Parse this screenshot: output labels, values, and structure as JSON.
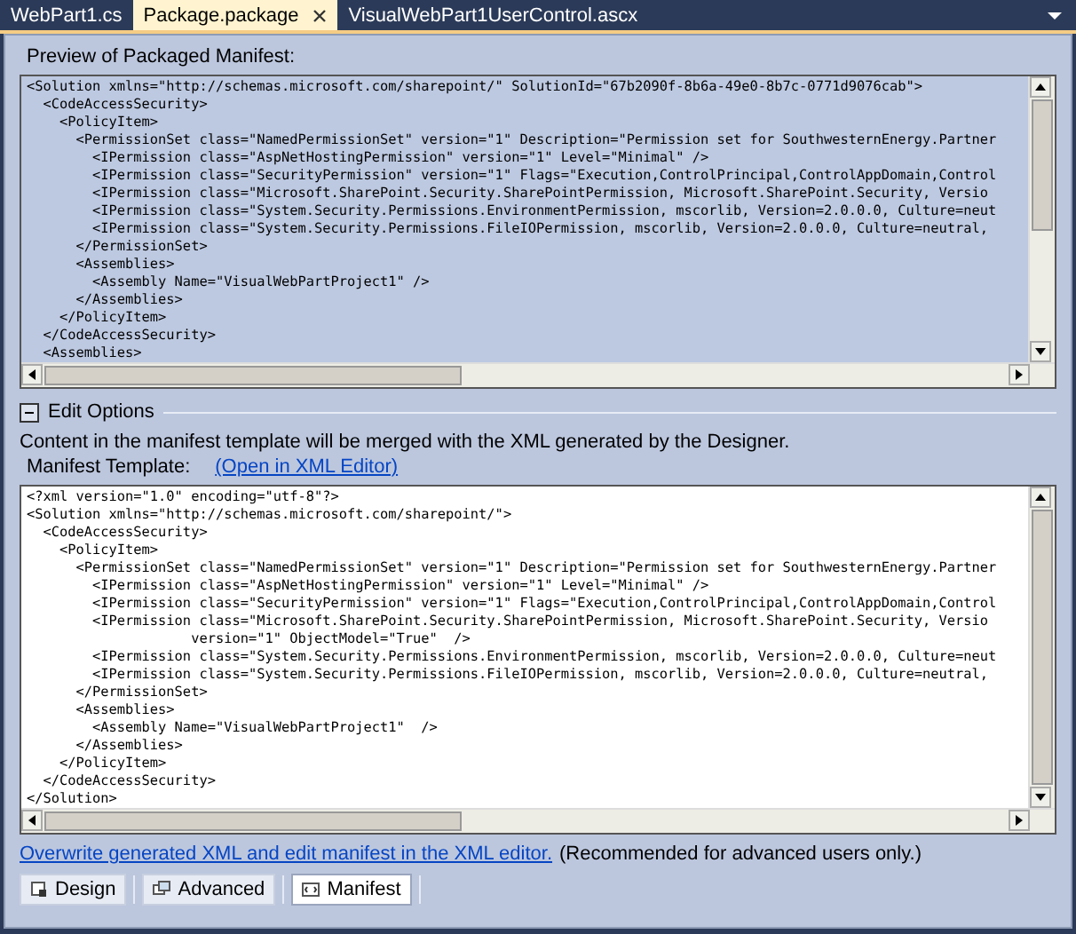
{
  "tabs": [
    {
      "label": "WebPart1.cs",
      "selected": false
    },
    {
      "label": "Package.package",
      "selected": true
    },
    {
      "label": "VisualWebPart1UserControl.ascx",
      "selected": false
    }
  ],
  "preview": {
    "label": "Preview of Packaged Manifest:",
    "lines": [
      "<Solution xmlns=\"http://schemas.microsoft.com/sharepoint/\" SolutionId=\"67b2090f-8b6a-49e0-8b7c-0771d9076cab\">",
      "  <CodeAccessSecurity>",
      "    <PolicyItem>",
      "      <PermissionSet class=\"NamedPermissionSet\" version=\"1\" Description=\"Permission set for SouthwesternEnergy.Partner",
      "        <IPermission class=\"AspNetHostingPermission\" version=\"1\" Level=\"Minimal\" />",
      "        <IPermission class=\"SecurityPermission\" version=\"1\" Flags=\"Execution,ControlPrincipal,ControlAppDomain,Control",
      "        <IPermission class=\"Microsoft.SharePoint.Security.SharePointPermission, Microsoft.SharePoint.Security, Versio",
      "        <IPermission class=\"System.Security.Permissions.EnvironmentPermission, mscorlib, Version=2.0.0.0, Culture=neut",
      "        <IPermission class=\"System.Security.Permissions.FileIOPermission, mscorlib, Version=2.0.0.0, Culture=neutral,",
      "      </PermissionSet>",
      "      <Assemblies>",
      "        <Assembly Name=\"VisualWebPartProject1\" />",
      "      </Assemblies>",
      "    </PolicyItem>",
      "  </CodeAccessSecurity>",
      "  <Assemblies>"
    ]
  },
  "edit_options": {
    "title": "Edit Options",
    "expanded": true,
    "description": "Content in the manifest template will be merged with the XML generated by the Designer.",
    "template_label": "Manifest Template:",
    "open_link": "(Open in XML Editor)",
    "lines": [
      "<?xml version=\"1.0\" encoding=\"utf-8\"?>",
      "<Solution xmlns=\"http://schemas.microsoft.com/sharepoint/\">",
      "  <CodeAccessSecurity>",
      "    <PolicyItem>",
      "      <PermissionSet class=\"NamedPermissionSet\" version=\"1\" Description=\"Permission set for SouthwesternEnergy.Partner",
      "        <IPermission class=\"AspNetHostingPermission\" version=\"1\" Level=\"Minimal\" />",
      "        <IPermission class=\"SecurityPermission\" version=\"1\" Flags=\"Execution,ControlPrincipal,ControlAppDomain,Control",
      "        <IPermission class=\"Microsoft.SharePoint.Security.SharePointPermission, Microsoft.SharePoint.Security, Versio",
      "                    version=\"1\" ObjectModel=\"True\"  />",
      "        <IPermission class=\"System.Security.Permissions.EnvironmentPermission, mscorlib, Version=2.0.0.0, Culture=neut",
      "        <IPermission class=\"System.Security.Permissions.FileIOPermission, mscorlib, Version=2.0.0.0, Culture=neutral,",
      "      </PermissionSet>",
      "      <Assemblies>",
      "        <Assembly Name=\"VisualWebPartProject1\"  />",
      "      </Assemblies>",
      "    </PolicyItem>",
      "  </CodeAccessSecurity>",
      "</Solution>"
    ]
  },
  "overwrite": {
    "link": "Overwrite generated XML and edit manifest in the XML editor.",
    "note": "(Recommended for advanced users only.)"
  },
  "view_tabs": [
    {
      "label": "Design",
      "kind": "design",
      "selected": false
    },
    {
      "label": "Advanced",
      "kind": "advanced",
      "selected": false
    },
    {
      "label": "Manifest",
      "kind": "manifest",
      "selected": true
    }
  ]
}
